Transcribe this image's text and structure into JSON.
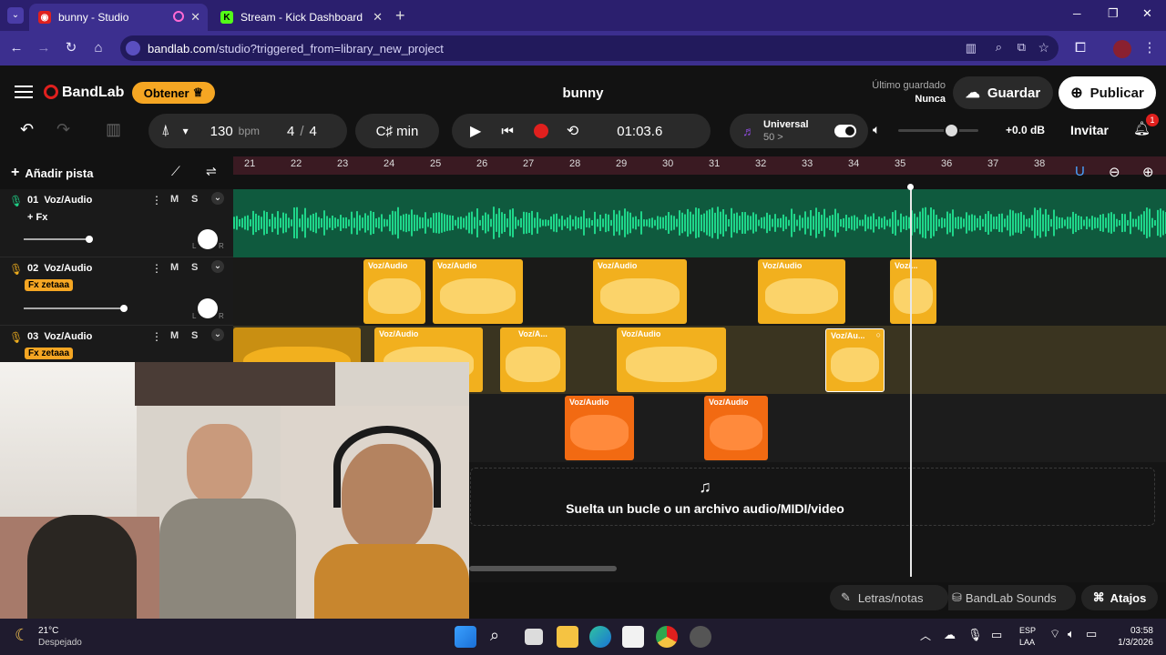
{
  "browser": {
    "tabs": [
      {
        "title": "bunny - Studio",
        "active": true
      },
      {
        "title": "Stream - Kick Dashboard",
        "active": false
      }
    ],
    "new_tab": "+",
    "url_host": "bandlab.com",
    "url_path": "/studio?triggered_from=library_new_project",
    "window": {
      "minimize": "─",
      "maximize": "❐",
      "close": "✕"
    }
  },
  "header": {
    "brand": "BandLab",
    "get_button": "Obtener",
    "project_title": "bunny",
    "last_saved_label": "Último guardado",
    "last_saved_value": "Nunca",
    "save_button": "Guardar",
    "publish_button": "Publicar"
  },
  "toolbar": {
    "bpm_value": "130",
    "bpm_unit": "bpm",
    "time_sig_num": "4",
    "time_sig_sep": "/",
    "time_sig_den": "4",
    "key": "C♯ min",
    "time": "01:03.6",
    "preset_name": "Universal",
    "preset_value": "50 >",
    "volume_db": "+0.0 dB",
    "invite": "Invitar",
    "notification_count": "1"
  },
  "tracks_panel": {
    "add_track": "Añadir pista"
  },
  "ruler": {
    "ticks": [
      "21",
      "22",
      "23",
      "24",
      "25",
      "26",
      "27",
      "28",
      "29",
      "30",
      "31",
      "32",
      "33",
      "34",
      "35",
      "36",
      "37",
      "38"
    ]
  },
  "tracks": [
    {
      "number": "01",
      "name": "Voz/Audio",
      "fx": "+ Fx",
      "mute": "M",
      "solo": "S",
      "pan_l": "L",
      "pan_r": "R"
    },
    {
      "number": "02",
      "name": "Voz/Audio",
      "fx": "Fx zetaaa",
      "mute": "M",
      "solo": "S",
      "pan_l": "L",
      "pan_r": "R"
    },
    {
      "number": "03",
      "name": "Voz/Audio",
      "fx": "Fx zetaaa",
      "mute": "M",
      "solo": "S"
    }
  ],
  "clips": {
    "track2": [
      "Voz/Audio",
      "Voz/Audio",
      "Voz/Audio",
      "Voz/Audio",
      "Voz/..."
    ],
    "track3": [
      "Voz/Audio",
      "Voz/A...",
      "Voz/Audio",
      "Voz/Au..."
    ],
    "track4": [
      "Voz/Audio",
      "Voz/Audio"
    ]
  },
  "drop_zone": "Suelta un bucle o un archivo audio/MIDI/video",
  "bottom": {
    "lyrics": "Letras/notas",
    "sounds": "BandLab Sounds",
    "shortcuts": "Atajos"
  },
  "taskbar": {
    "temp": "21°C",
    "weather": "Despejado",
    "lang1": "ESP",
    "lang2": "LAA",
    "time": "03:58",
    "date": "1/3/2026"
  },
  "colors": {
    "accent_green": "#1fd68a",
    "clip_yellow": "#f2b01e",
    "clip_orange": "#f26a12",
    "record_red": "#e0201e",
    "browser_purple": "#3c2f8f"
  }
}
